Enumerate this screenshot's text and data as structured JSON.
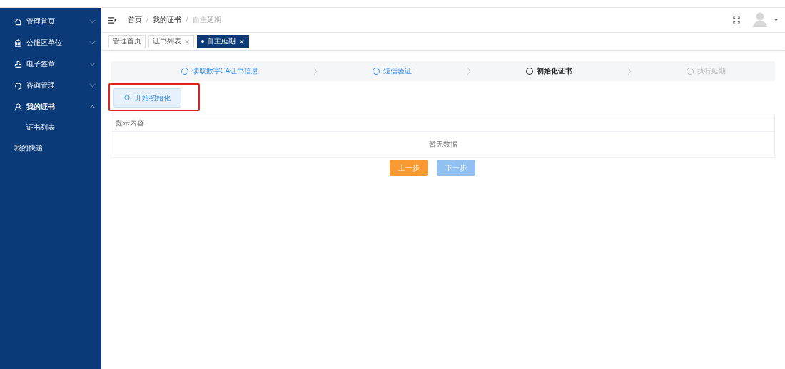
{
  "sidebar": {
    "items": [
      {
        "label": "管理首页",
        "expanded": false
      },
      {
        "label": "公服区单位",
        "expanded": false
      },
      {
        "label": "电子签章",
        "expanded": false
      },
      {
        "label": "咨询管理",
        "expanded": false
      },
      {
        "label": "我的证书",
        "expanded": true,
        "children": [
          {
            "label": "证书列表",
            "selected": false
          }
        ]
      },
      {
        "label": "我的快递"
      }
    ]
  },
  "breadcrumb": [
    {
      "label": "首页",
      "current": false
    },
    {
      "label": "我的证书",
      "current": false
    },
    {
      "label": "自主延期",
      "current": true
    }
  ],
  "breadcrumb_separator": "/",
  "tabs": [
    {
      "label": "管理首页",
      "selected": false
    },
    {
      "label": "证书列表",
      "close": "×",
      "selected": false
    },
    {
      "label": "自主延期",
      "close": "×",
      "selected": true
    }
  ],
  "steps": [
    {
      "label": "读取数字CA证书信息",
      "finished": true,
      "current": false
    },
    {
      "label": "短信验证",
      "finished": true,
      "current": false
    },
    {
      "label": "初始化证书",
      "finished": false,
      "current": true
    },
    {
      "label": "执行延期",
      "finished": false,
      "current": false
    }
  ],
  "start_button": {
    "label": "开始初始化",
    "highlighted": true
  },
  "table": {
    "columns": [
      "提示内容"
    ],
    "empty_text": "暂无数据"
  },
  "buttons": [
    {
      "label": "上一步",
      "kind": "primary",
      "disabled": false
    },
    {
      "label": "下一步",
      "kind": "secondary",
      "disabled": true
    }
  ]
}
